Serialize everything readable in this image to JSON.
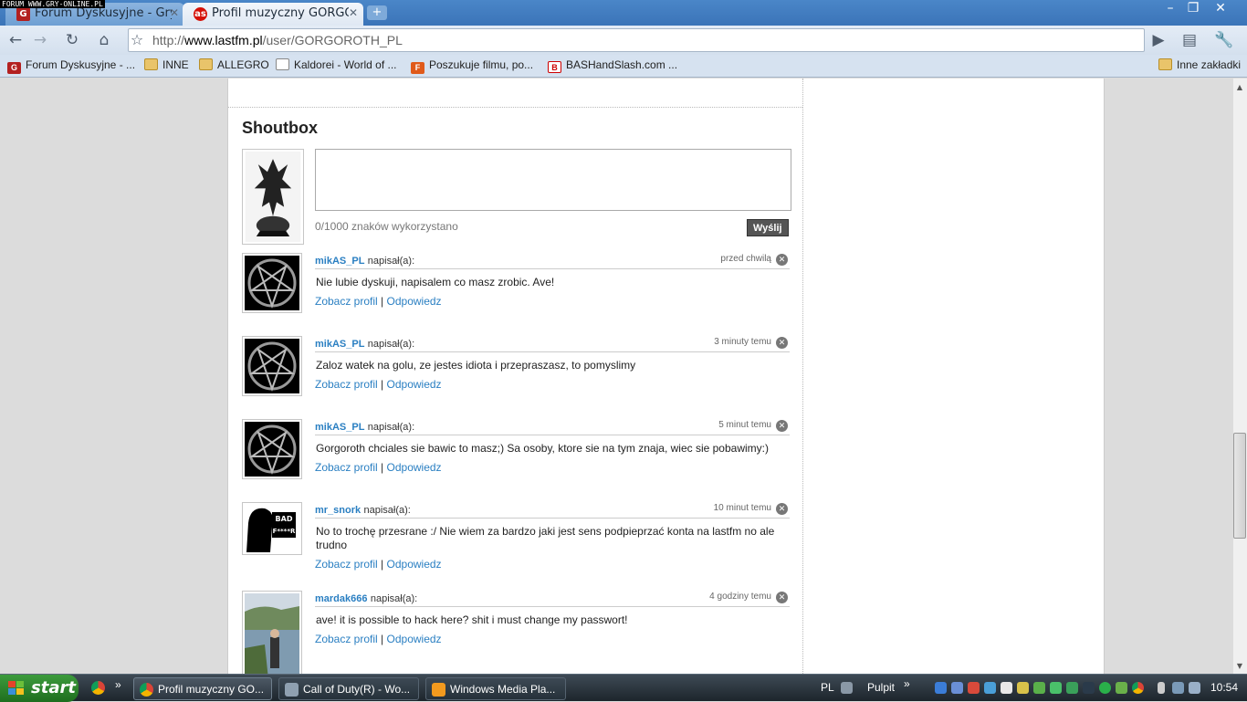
{
  "watermark": "FORUM WWW.GRY-ONLINE.PL",
  "tabs": [
    {
      "label": "Forum Dyskusyjne - Gry-...",
      "favicon": "G",
      "favicon_color": "#b32020"
    },
    {
      "label": "Profil muzyczny GORGO...",
      "favicon": "as",
      "favicon_color": "#d51007"
    }
  ],
  "toolbar": {
    "url_prefix": "http://",
    "url_host": "www.lastfm.pl",
    "url_path": "/user/GORGOROTH_PL"
  },
  "bookmarks": [
    {
      "label": "Forum Dyskusyjne - ...",
      "icon": "gry-online-icon"
    },
    {
      "label": "INNE",
      "icon": "folder-icon"
    },
    {
      "label": "ALLEGRO",
      "icon": "folder-icon"
    },
    {
      "label": "Kaldorei - World of ...",
      "icon": "page-icon"
    },
    {
      "label": "Poszukuje filmu, po...",
      "icon": "f-icon"
    },
    {
      "label": "BASHandSlash.com ...",
      "icon": "bash-icon"
    }
  ],
  "other_bookmarks": "Inne zakładki",
  "shoutbox": {
    "title": "Shoutbox",
    "counter": "0/1000 znaków wykorzystano",
    "send_label": "Wyślij",
    "wrote_label": "napisał(a):",
    "profile_link": "Zobacz profil",
    "reply_link": "Odpowiedz",
    "separator": "|",
    "entries": [
      {
        "user": "mikAS_PL",
        "time": "przed chwilą",
        "message": "Nie lubie dyskuji, napisalem co masz zrobic. Ave!",
        "avatar": "pentagram"
      },
      {
        "user": "mikAS_PL",
        "time": "3 minuty temu",
        "message": "Zaloz watek na golu, ze jestes idiota i przepraszasz, to pomyslimy",
        "avatar": "pentagram"
      },
      {
        "user": "mikAS_PL",
        "time": "5 minut temu",
        "message": "Gorgoroth chciales sie bawic to masz;) Sa osoby, ktore sie na tym znaja, wiec sie pobawimy:)",
        "avatar": "pentagram"
      },
      {
        "user": "mr_snork",
        "time": "10 minut temu",
        "message": "No to trochę przesrane :/ Nie wiem za bardzo jaki jest sens podpieprzać konta na lastfm no ale trudno",
        "avatar": "bad-mother"
      },
      {
        "user": "mardak666",
        "time": "4 godziny temu",
        "message": "ave! it is possible to hack here? shit i must change my passwort!",
        "avatar": "photo"
      }
    ]
  },
  "taskbar": {
    "start_label": "start",
    "tasks": [
      {
        "label": "Profil muzyczny GO...",
        "active": true
      },
      {
        "label": "Call of Duty(R) - Wo...",
        "active": false
      },
      {
        "label": "Windows Media Pla...",
        "active": false
      }
    ],
    "language": "PL",
    "desktop_label": "Pulpit",
    "clock": "10:54"
  }
}
